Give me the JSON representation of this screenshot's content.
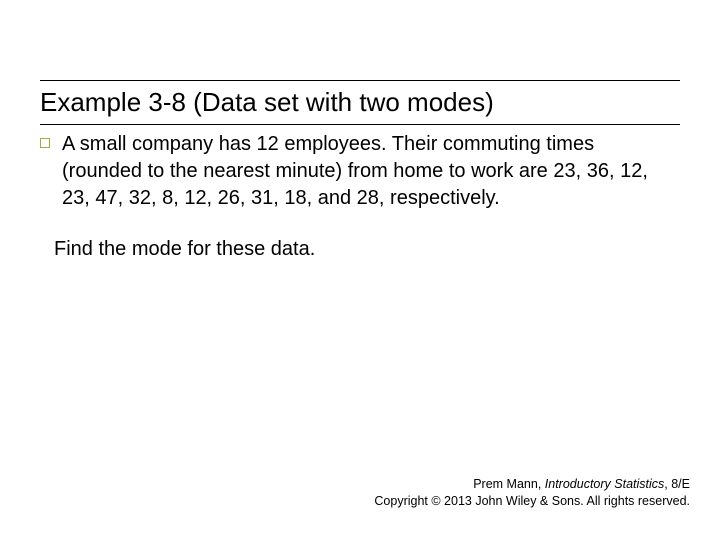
{
  "title": "Example 3-8 (Data set with two modes)",
  "body": "A small company has 12 employees. Their commuting times (rounded to the nearest minute) from home to work are 23, 36, 12, 23, 47, 32, 8, 12, 26, 31, 18, and 28, respectively.",
  "prompt": "Find the mode for these data.",
  "footer": {
    "author": "Prem Mann, ",
    "book": "Introductory Statistics",
    "edition": ", 8/E",
    "copyright": "Copyright © 2013 John Wiley & Sons. All rights reserved."
  }
}
